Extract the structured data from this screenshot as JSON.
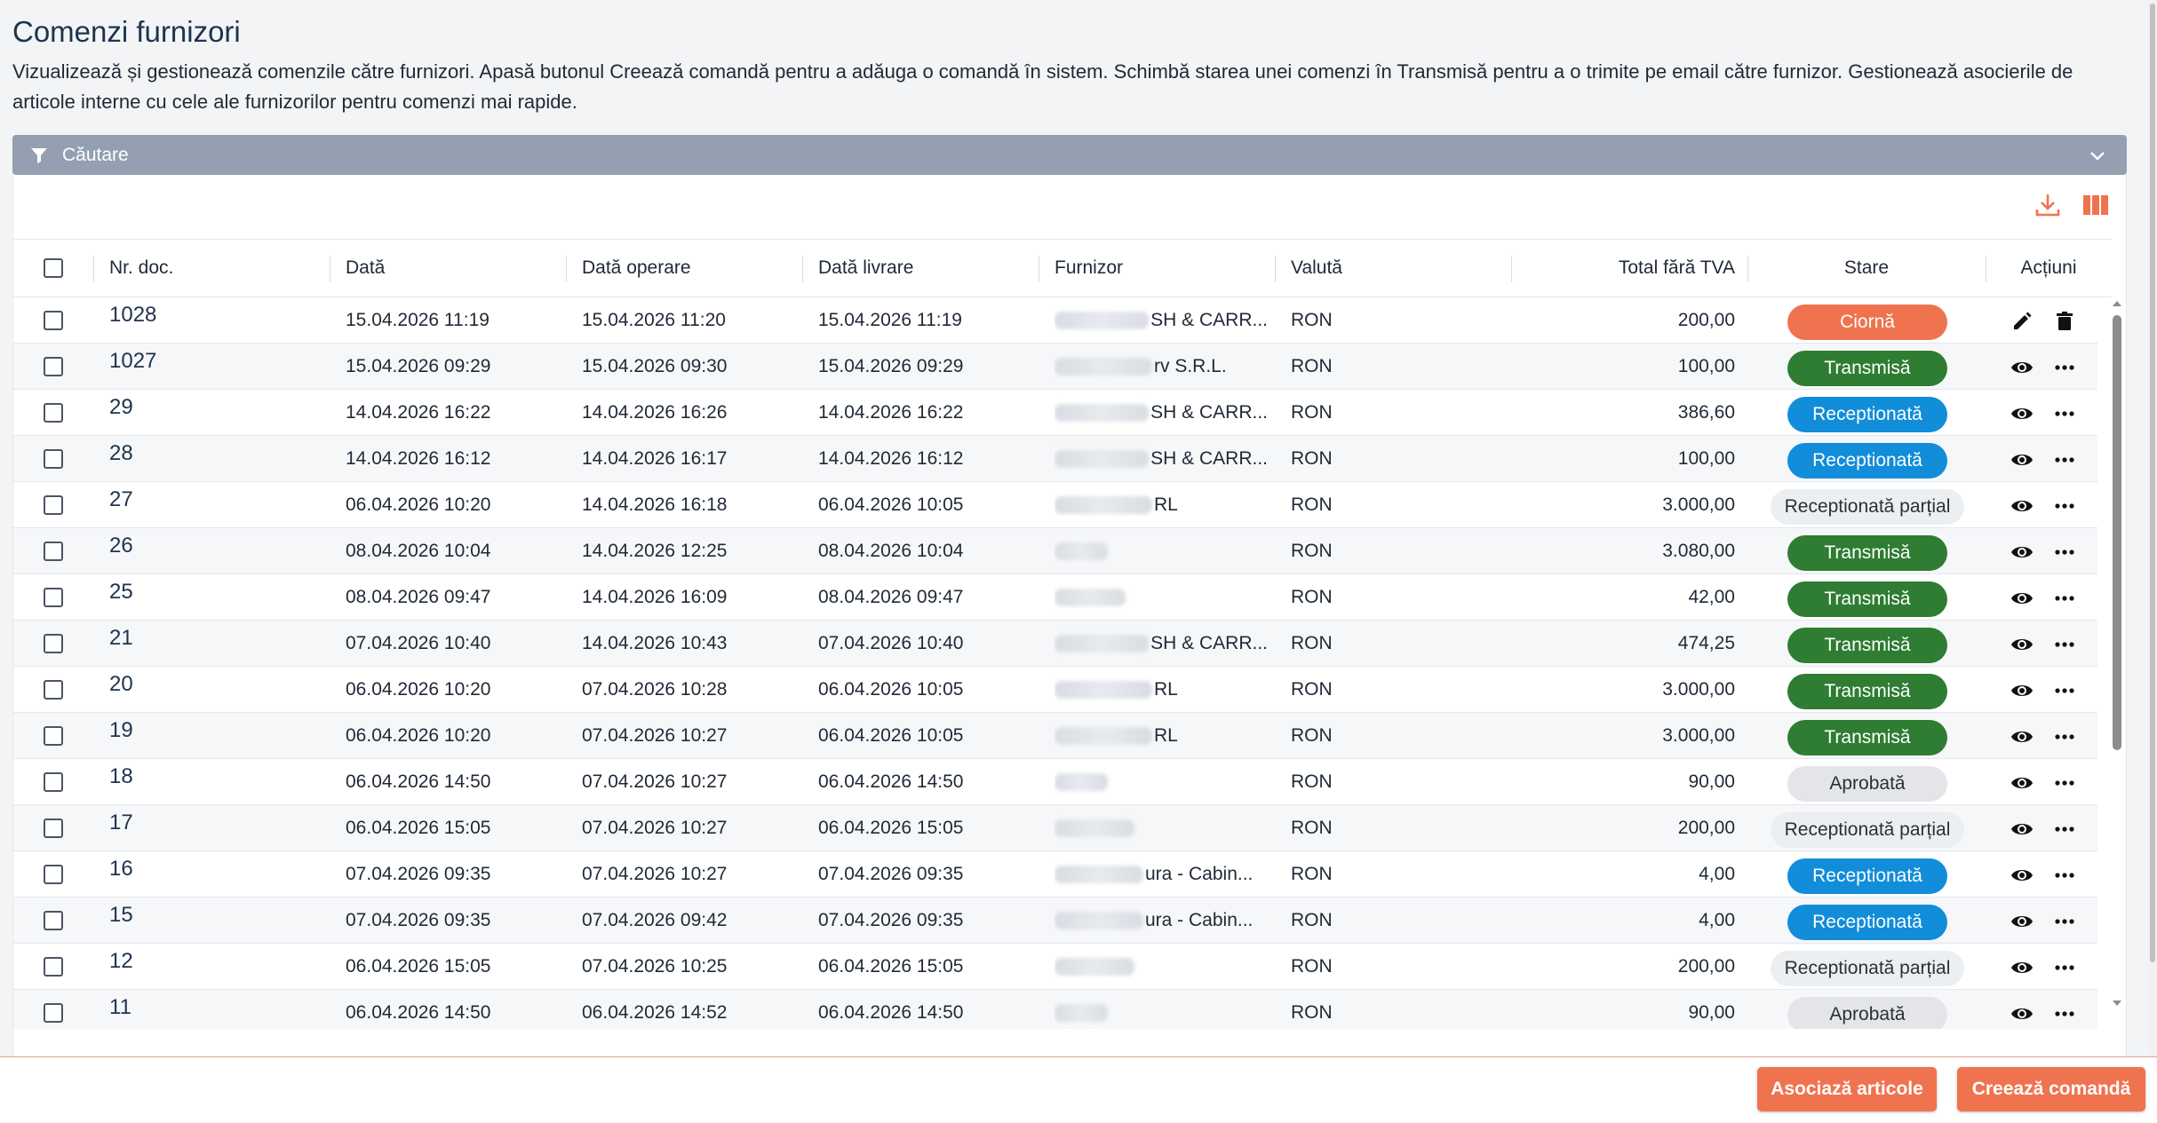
{
  "header": {
    "title": "Comenzi furnizori",
    "description": "Vizualizează și gestionează comenzile către furnizori. Apasă butonul Creează comandă pentru a adăuga o comandă în sistem. Schimbă starea unei comenzi în Transmisă pentru a o trimite pe email către furnizor. Gestionează asocierile de articole interne cu cele ale furnizorilor pentru comenzi mai rapide."
  },
  "search": {
    "label": "Căutare"
  },
  "toolbar": {
    "icons": [
      "download-icon",
      "columns-icon"
    ],
    "accent": "#f0734f"
  },
  "table": {
    "columns": {
      "doc_nr": "Nr. doc.",
      "data": "Dată",
      "data_operare": "Dată operare",
      "data_livrare": "Dată livrare",
      "furnizor": "Furnizor",
      "valuta": "Valută",
      "total": "Total fără TVA",
      "stare": "Stare",
      "actiuni": "Acțiuni"
    },
    "rows": [
      {
        "doc": "1028",
        "data": "15.04.2026 11:19",
        "operare": "15.04.2026 11:20",
        "livrare": "15.04.2026 11:19",
        "furnizor_visible": "SH & CARR...",
        "valuta": "RON",
        "total": "200,00",
        "stare": "Ciornă",
        "stare_kind": "ciorna",
        "actions": [
          "edit-icon",
          "trash-icon"
        ]
      },
      {
        "doc": "1027",
        "data": "15.04.2026 09:29",
        "operare": "15.04.2026 09:30",
        "livrare": "15.04.2026 09:29",
        "furnizor_visible": "rv S.R.L.",
        "valuta": "RON",
        "total": "100,00",
        "stare": "Transmisă",
        "stare_kind": "transmisa",
        "actions": [
          "eye-icon",
          "more-icon"
        ]
      },
      {
        "doc": "29",
        "data": "14.04.2026 16:22",
        "operare": "14.04.2026 16:26",
        "livrare": "14.04.2026 16:22",
        "furnizor_visible": "SH & CARR...",
        "valuta": "RON",
        "total": "386,60",
        "stare": "Receptionată",
        "stare_kind": "receptionata",
        "actions": [
          "eye-icon",
          "more-icon"
        ]
      },
      {
        "doc": "28",
        "data": "14.04.2026 16:12",
        "operare": "14.04.2026 16:17",
        "livrare": "14.04.2026 16:12",
        "furnizor_visible": "SH & CARR...",
        "valuta": "RON",
        "total": "100,00",
        "stare": "Receptionată",
        "stare_kind": "receptionata",
        "actions": [
          "eye-icon",
          "more-icon"
        ]
      },
      {
        "doc": "27",
        "data": "06.04.2026 10:20",
        "operare": "14.04.2026 16:18",
        "livrare": "06.04.2026 10:05",
        "furnizor_visible": "RL",
        "valuta": "RON",
        "total": "3.000,00",
        "stare": "Receptionată parțial",
        "stare_kind": "partial",
        "actions": [
          "eye-icon",
          "more-icon"
        ]
      },
      {
        "doc": "26",
        "data": "08.04.2026 10:04",
        "operare": "14.04.2026 12:25",
        "livrare": "08.04.2026 10:04",
        "furnizor_visible": "",
        "valuta": "RON",
        "total": "3.080,00",
        "stare": "Transmisă",
        "stare_kind": "transmisa",
        "actions": [
          "eye-icon",
          "more-icon"
        ]
      },
      {
        "doc": "25",
        "data": "08.04.2026 09:47",
        "operare": "14.04.2026 16:09",
        "livrare": "08.04.2026 09:47",
        "furnizor_visible": "",
        "valuta": "RON",
        "total": "42,00",
        "stare": "Transmisă",
        "stare_kind": "transmisa",
        "actions": [
          "eye-icon",
          "more-icon"
        ]
      },
      {
        "doc": "21",
        "data": "07.04.2026 10:40",
        "operare": "14.04.2026 10:43",
        "livrare": "07.04.2026 10:40",
        "furnizor_visible": "SH & CARR...",
        "valuta": "RON",
        "total": "474,25",
        "stare": "Transmisă",
        "stare_kind": "transmisa",
        "actions": [
          "eye-icon",
          "more-icon"
        ]
      },
      {
        "doc": "20",
        "data": "06.04.2026 10:20",
        "operare": "07.04.2026 10:28",
        "livrare": "06.04.2026 10:05",
        "furnizor_visible": "RL",
        "valuta": "RON",
        "total": "3.000,00",
        "stare": "Transmisă",
        "stare_kind": "transmisa",
        "actions": [
          "eye-icon",
          "more-icon"
        ]
      },
      {
        "doc": "19",
        "data": "06.04.2026 10:20",
        "operare": "07.04.2026 10:27",
        "livrare": "06.04.2026 10:05",
        "furnizor_visible": "RL",
        "valuta": "RON",
        "total": "3.000,00",
        "stare": "Transmisă",
        "stare_kind": "transmisa",
        "actions": [
          "eye-icon",
          "more-icon"
        ]
      },
      {
        "doc": "18",
        "data": "06.04.2026 14:50",
        "operare": "07.04.2026 10:27",
        "livrare": "06.04.2026 14:50",
        "furnizor_visible": "",
        "valuta": "RON",
        "total": "90,00",
        "stare": "Aprobată",
        "stare_kind": "aprobata",
        "actions": [
          "eye-icon",
          "more-icon"
        ]
      },
      {
        "doc": "17",
        "data": "06.04.2026 15:05",
        "operare": "07.04.2026 10:27",
        "livrare": "06.04.2026 15:05",
        "furnizor_visible": "",
        "valuta": "RON",
        "total": "200,00",
        "stare": "Receptionată parțial",
        "stare_kind": "partial",
        "actions": [
          "eye-icon",
          "more-icon"
        ]
      },
      {
        "doc": "16",
        "data": "07.04.2026 09:35",
        "operare": "07.04.2026 10:27",
        "livrare": "07.04.2026 09:35",
        "furnizor_visible": "ura - Cabin...",
        "valuta": "RON",
        "total": "4,00",
        "stare": "Receptionată",
        "stare_kind": "receptionata",
        "actions": [
          "eye-icon",
          "more-icon"
        ]
      },
      {
        "doc": "15",
        "data": "07.04.2026 09:35",
        "operare": "07.04.2026 09:42",
        "livrare": "07.04.2026 09:35",
        "furnizor_visible": "ura - Cabin...",
        "valuta": "RON",
        "total": "4,00",
        "stare": "Receptionată",
        "stare_kind": "receptionata",
        "actions": [
          "eye-icon",
          "more-icon"
        ]
      },
      {
        "doc": "12",
        "data": "06.04.2026 15:05",
        "operare": "07.04.2026 10:25",
        "livrare": "06.04.2026 15:05",
        "furnizor_visible": "",
        "valuta": "RON",
        "total": "200,00",
        "stare": "Receptionată parțial",
        "stare_kind": "partial",
        "actions": [
          "eye-icon",
          "more-icon"
        ]
      },
      {
        "doc": "11",
        "data": "06.04.2026 14:50",
        "operare": "06.04.2026 14:52",
        "livrare": "06.04.2026 14:50",
        "furnizor_visible": "",
        "valuta": "RON",
        "total": "90,00",
        "stare": "Aprobată",
        "stare_kind": "aprobata",
        "actions": [
          "eye-icon",
          "more-icon"
        ]
      }
    ]
  },
  "footer": {
    "asociaza_label": "Asociază articole",
    "creeaza_label": "Creează comandă"
  },
  "colors": {
    "accent": "#f0734f",
    "transmisa": "#2e7d32",
    "receptionata": "#118dd9",
    "search_bar": "#94a0b1",
    "title": "#1e3350"
  }
}
